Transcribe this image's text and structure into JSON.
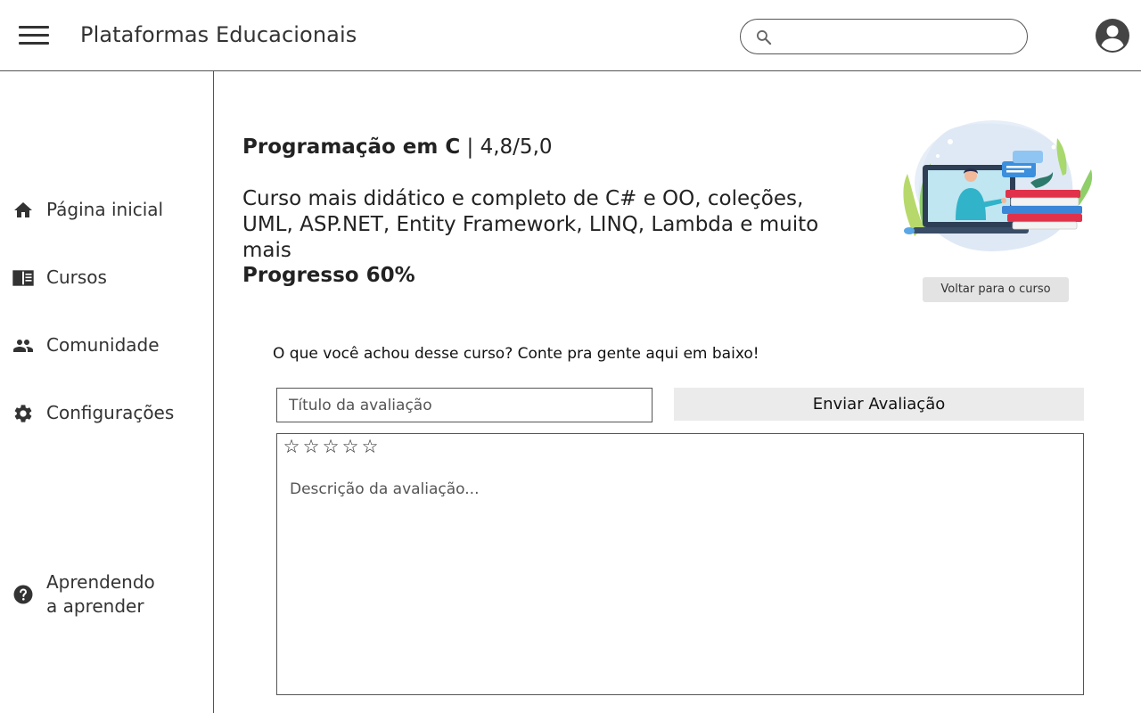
{
  "header": {
    "title": "Plataformas Educacionais",
    "search_placeholder": "",
    "menu_icon": "hamburger-menu-icon",
    "avatar_icon": "account-circle-icon"
  },
  "sidebar": {
    "items": [
      {
        "label": "Página inicial",
        "icon": "home-icon"
      },
      {
        "label": "Cursos",
        "icon": "book-icon"
      },
      {
        "label": "Comunidade",
        "icon": "people-icon"
      },
      {
        "label": "Configurações",
        "icon": "gear-icon"
      }
    ],
    "help": {
      "line1": "Aprendendo",
      "line2": "a aprender",
      "icon": "help-circle-icon"
    }
  },
  "course": {
    "name": "Programação em C",
    "rating_text": " | 4,8/5,0",
    "rating": 4.8,
    "rating_max": 5.0,
    "description": "Curso mais didático e completo de C# e OO, coleções, UML, ASP.NET, Entity Framework, LINQ, Lambda e muito mais",
    "progress_label": "Progresso 60%",
    "progress_percent": 60,
    "back_button": "Voltar para o curso"
  },
  "review": {
    "prompt": "O que você achou desse curso? Conte pra gente aqui em baixo!",
    "title_placeholder": "Título da avaliação",
    "submit_label": "Enviar Avaliação",
    "stars_selected": 0,
    "stars_total": 5,
    "star_glyph": "☆",
    "description_placeholder": "Descrição da avaliação..."
  },
  "colors": {
    "border": "#555555",
    "button_bg": "#ebebeb",
    "back_button_bg": "#e3e3e3",
    "text": "#222222"
  }
}
